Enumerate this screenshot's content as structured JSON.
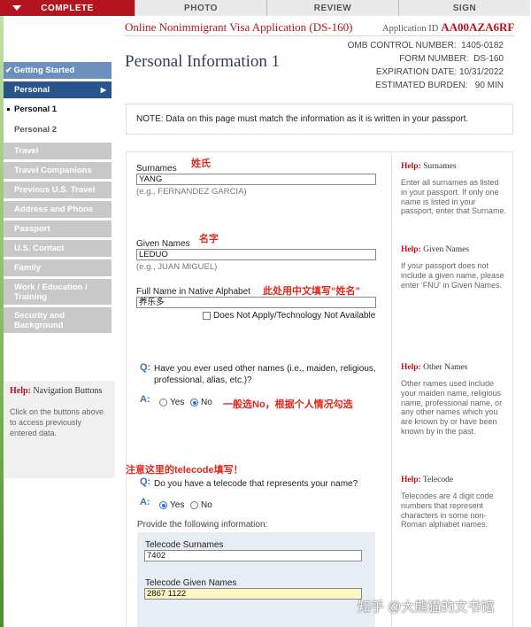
{
  "nav": {
    "tabs": [
      {
        "label": "COMPLETE",
        "state": "active"
      },
      {
        "label": "PHOTO",
        "state": "inactive"
      },
      {
        "label": "REVIEW",
        "state": "inactive"
      },
      {
        "label": "SIGN",
        "state": "inactive"
      }
    ],
    "accent_color": "#b4141e"
  },
  "sidebar": {
    "getting_started": "Getting Started",
    "personal": "Personal",
    "personal_arrow": "▶",
    "sub_items": [
      "Personal 1",
      "Personal 2"
    ],
    "sections": [
      "Travel",
      "Travel Companions",
      "Previous U.S. Travel",
      "Address and Phone",
      "Passport",
      "U.S. Contact",
      "Family",
      "Work / Education / Training",
      "Security and Background"
    ]
  },
  "help_nav": {
    "label": "Help:",
    "title": "Navigation Buttons",
    "body": "Click on the buttons above to access previously entered data."
  },
  "header": {
    "app_title": "Online Nonimmigrant Visa Application (DS-160)",
    "app_id_label": "Application ID",
    "app_id": "AA00AZA6RF",
    "page_title": "Personal Information 1",
    "omb": [
      {
        "label": "OMB CONTROL NUMBER:",
        "value": "1405-0182"
      },
      {
        "label": "FORM NUMBER:",
        "value": "DS-160"
      },
      {
        "label": "EXPIRATION DATE:",
        "value": "10/31/2022"
      },
      {
        "label": "ESTIMATED BURDEN:",
        "value": "90 MIN"
      }
    ]
  },
  "note": "NOTE: Data on this page must match the information as it is written in your passport.",
  "form": {
    "surnames": {
      "label": "Surnames",
      "value": "YANG",
      "hint": "(e.g., FERNANDEZ GARCIA)",
      "annotation": "姓氏"
    },
    "given_names": {
      "label": "Given Names",
      "value": "LEDUO",
      "hint": "(e.g., JUAN MIGUEL)",
      "annotation": "名字"
    },
    "native_name": {
      "label": "Full Name in Native Alphabet",
      "value": "养乐多",
      "annotation": "此处用中文填写“姓名”",
      "na_label": "Does Not Apply/Technology Not Available"
    },
    "other_names": {
      "q": "Q:",
      "a": "A:",
      "question": "Have you ever used other names (i.e., maiden, religious, professional, alias, etc.)?",
      "yes": "Yes",
      "no": "No",
      "selected": "No",
      "annotation": "一般选No，根据个人情况勾选"
    },
    "telecode_note": "注意这里的telecode填写！",
    "telecode": {
      "q": "Q:",
      "a": "A:",
      "question": "Do you have a telecode that represents your name?",
      "yes": "Yes",
      "no": "No",
      "selected": "Yes",
      "provide": "Provide the following information:",
      "surnames_label": "Telecode Surnames",
      "surnames_value": "7402",
      "given_label": "Telecode Given Names",
      "given_value": "2867 1122"
    }
  },
  "help": [
    {
      "label": "Help:",
      "title": "Surnames",
      "body": "Enter all surnames as listed in your passport. If only one name is listed in your passport, enter that Surname."
    },
    {
      "label": "Help:",
      "title": "Given Names",
      "body": "If your passport does not include a given name, please enter 'FNU' in Given Names."
    },
    {
      "label": "Help:",
      "title": "Other Names",
      "body": "Other names used include your maiden name, religious name, professional name, or any other names which you are known by or have been known by in the past."
    },
    {
      "label": "Help:",
      "title": "Telecode",
      "body": "Telecodes are 4 digit code numbers that represent characters in some non-Roman alphabet names."
    }
  ],
  "watermark": "知乎 @大熊猫的文书馆"
}
